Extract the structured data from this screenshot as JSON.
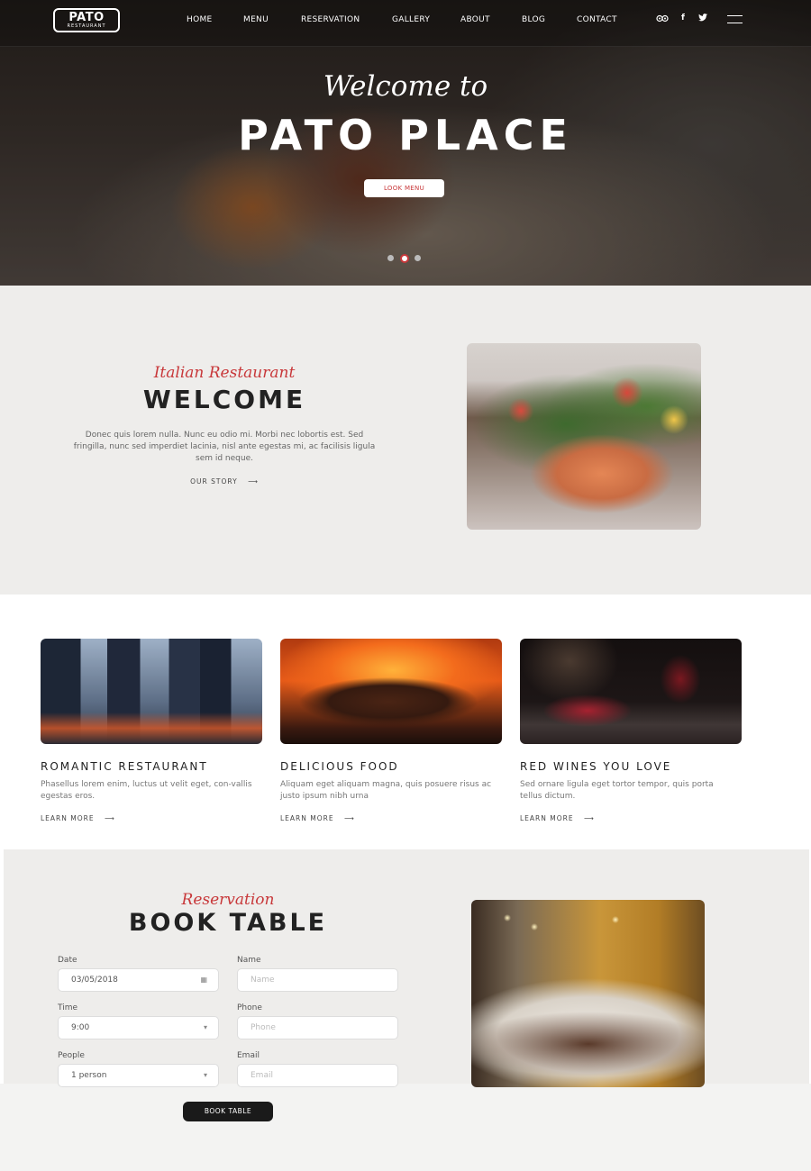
{
  "nav": {
    "logo_main": "PATO",
    "logo_sub": "RESTAURANT",
    "items": [
      "HOME",
      "MENU",
      "RESERVATION",
      "GALLERY",
      "ABOUT",
      "BLOG",
      "CONTACT"
    ],
    "social": [
      "tripadvisor",
      "f",
      "twitter"
    ]
  },
  "hero": {
    "script": "Welcome to",
    "title": "PATO PLACE",
    "button": "LOOK MENU",
    "slide_active": 2,
    "slide_count": 3
  },
  "welcome": {
    "script": "Italian Restaurant",
    "title": "WELCOME",
    "body": "Donec quis lorem nulla. Nunc eu odio mi. Morbi nec lobortis est. Sed fringilla, nunc sed imperdiet lacinia, nisl ante egestas mi, ac facilisis ligula sem id neque.",
    "link": "OUR STORY"
  },
  "features": [
    {
      "title": "ROMANTIC RESTAURANT",
      "text": "Phasellus lorem enim, luctus ut velit eget, con-vallis egestas eros.",
      "link": "LEARN MORE"
    },
    {
      "title": "DELICIOUS FOOD",
      "text": "Aliquam eget aliquam magna, quis posuere risus ac justo ipsum nibh urna",
      "link": "LEARN MORE"
    },
    {
      "title": "RED WINES YOU LOVE",
      "text": "Sed ornare ligula eget tortor tempor, quis porta tellus dictum.",
      "link": "LEARN MORE"
    }
  ],
  "reservation": {
    "script": "Reservation",
    "title": "BOOK TABLE",
    "date_label": "Date",
    "date_value": "03/05/2018",
    "time_label": "Time",
    "time_value": "9:00",
    "people_label": "People",
    "people_value": "1 person",
    "name_label": "Name",
    "name_placeholder": "Name",
    "phone_label": "Phone",
    "phone_placeholder": "Phone",
    "email_label": "Email",
    "email_placeholder": "Email",
    "button": "BOOK TABLE"
  },
  "colors": {
    "accent": "#c8383a",
    "dark": "#1a1a1a",
    "section_bg": "#eeedeb"
  }
}
